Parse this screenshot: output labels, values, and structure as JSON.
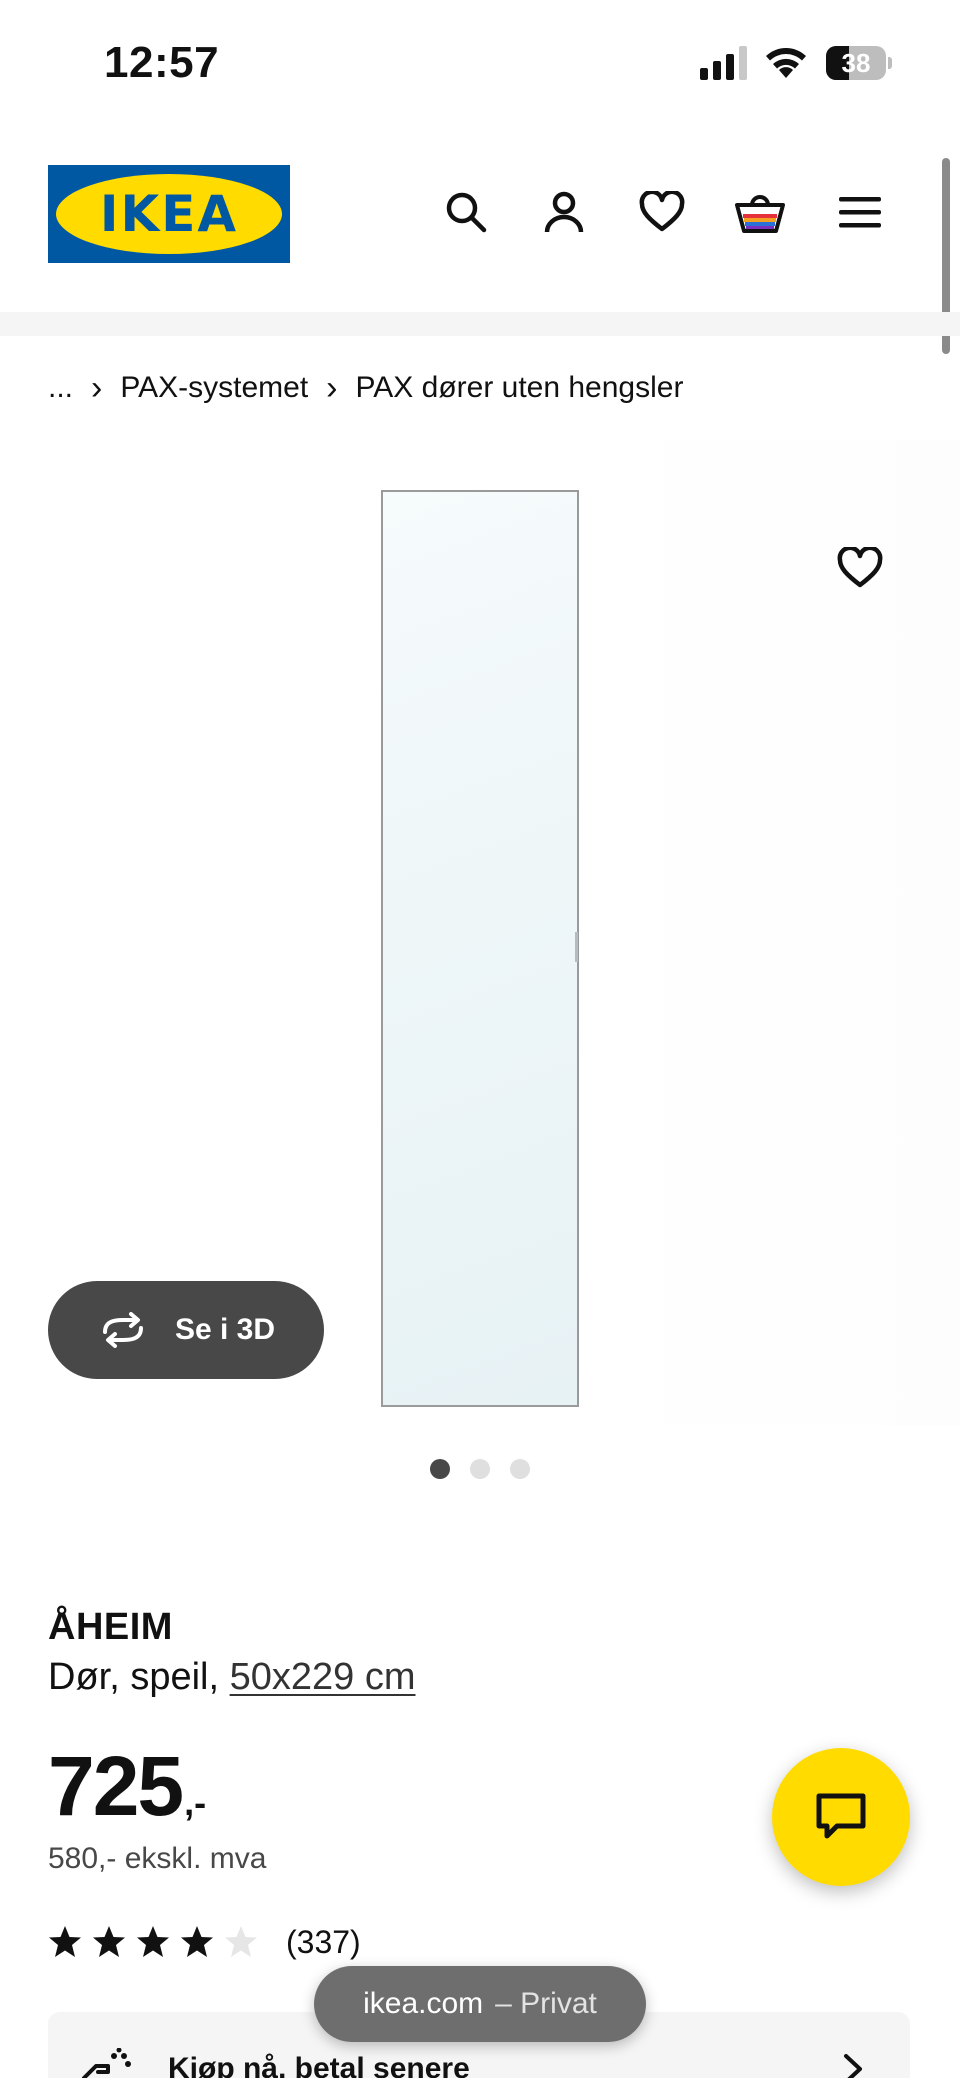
{
  "status_bar": {
    "time": "12:57",
    "battery": "38",
    "battery_level": 0.38
  },
  "header": {
    "logo_text": "IKEA",
    "icons": [
      "search-icon",
      "account-icon",
      "favorites-icon",
      "cart-icon",
      "menu-icon"
    ]
  },
  "breadcrumb": {
    "ellipsis": "...",
    "items": [
      "PAX-systemet",
      "PAX dører uten hengsler"
    ]
  },
  "gallery": {
    "view_3d_label": "Se i 3D",
    "dot_count": 3,
    "active_index": 0
  },
  "product": {
    "name": "ÅHEIM",
    "description_prefix": "Dør, speil, ",
    "size": "50x229 cm",
    "price_integer": "725",
    "price_suffix": ",-",
    "price_excl_vat": "580,- ekskl. mva",
    "rating": 4,
    "rating_max": 5,
    "review_count": "(337)"
  },
  "pay_later": {
    "label": "Kjøp nå, betal senere"
  },
  "browser": {
    "domain": "ikea.com",
    "mode": "– Privat"
  },
  "colors": {
    "ikea_blue": "#0058a3",
    "ikea_yellow": "#ffdb00",
    "button_dark": "#484848"
  }
}
